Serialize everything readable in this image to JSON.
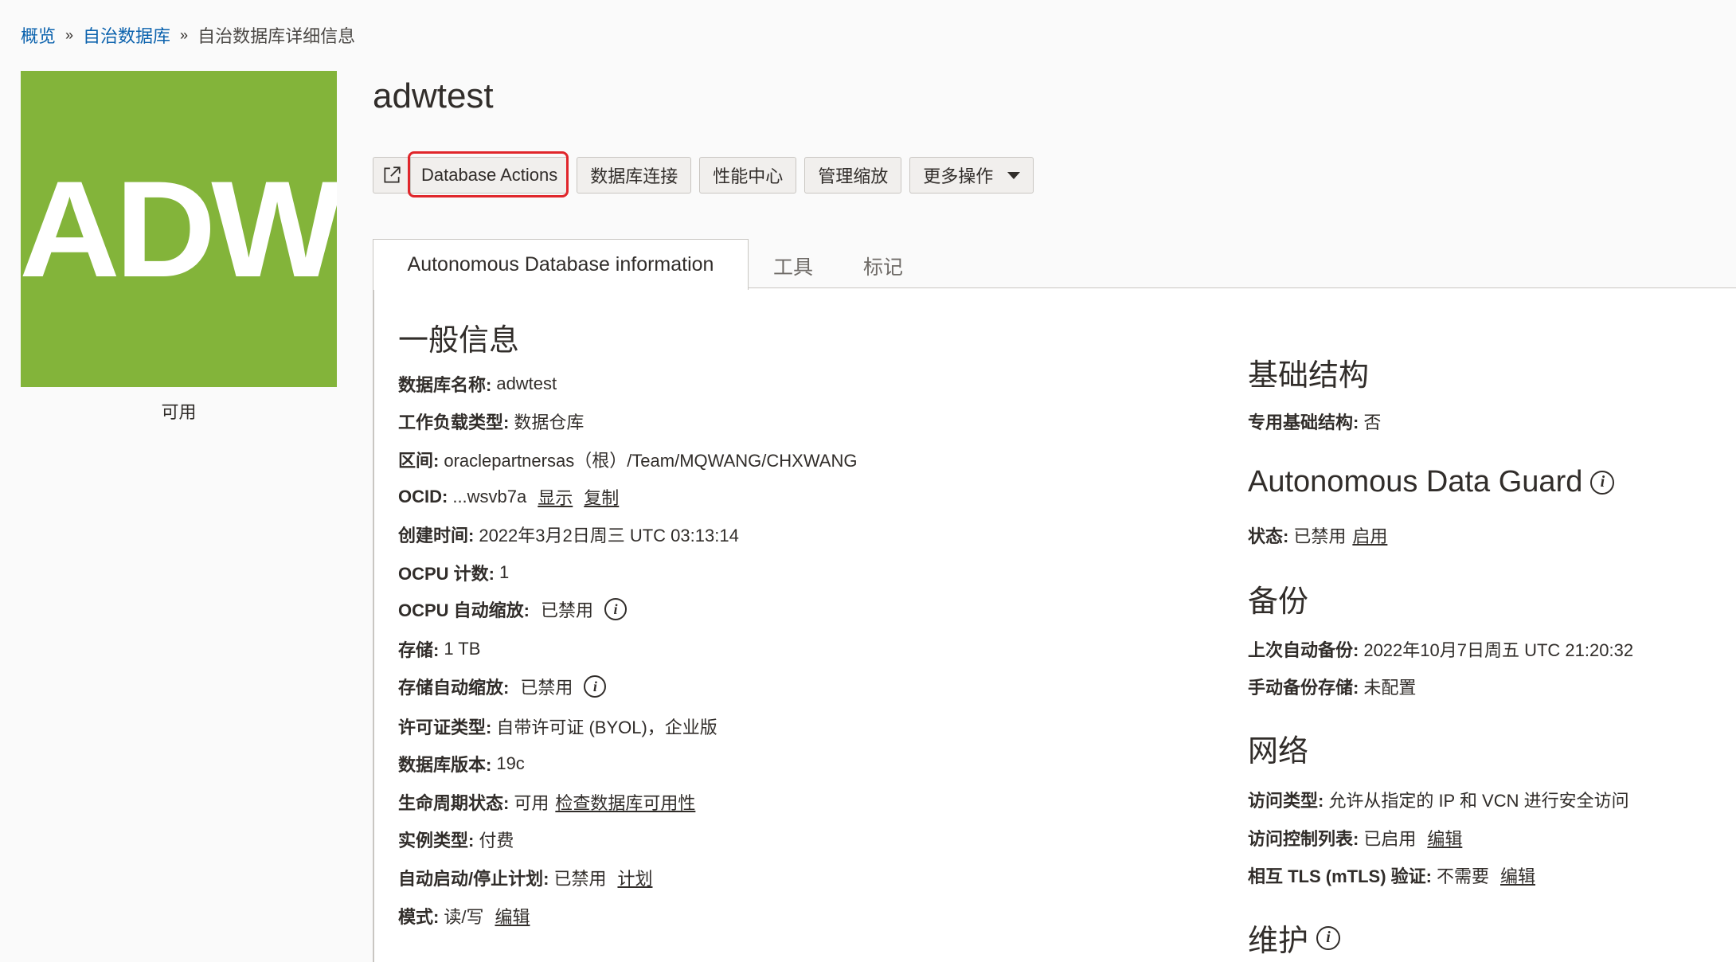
{
  "breadcrumb": {
    "items": [
      "概览",
      "自治数据库"
    ],
    "current": "自治数据库详细信息",
    "separator": "»"
  },
  "logo": {
    "text": "ADW",
    "color": "#83b43a"
  },
  "lifecycle_label": "可用",
  "title": "adwtest",
  "toolbar": {
    "open_icon": "external-link-icon",
    "database_actions": "Database Actions",
    "db_connection": "数据库连接",
    "performance_hub": "性能中心",
    "manage_scaling": "管理缩放",
    "more_actions": "更多操作"
  },
  "tabs": {
    "active": "Autonomous Database information",
    "tools": "工具",
    "tags": "标记"
  },
  "general": {
    "heading": "一般信息",
    "db_name": {
      "key": "数据库名称:",
      "value": "adwtest"
    },
    "workload": {
      "key": "工作负载类型:",
      "value": "数据仓库"
    },
    "compartment": {
      "key": "区间:",
      "value": "oraclepartnersas（根）/Team/MQWANG/CHXWANG"
    },
    "ocid": {
      "key": "OCID:",
      "value": "...wsvb7a",
      "show": "显示",
      "copy": "复制"
    },
    "created": {
      "key": "创建时间:",
      "value": "2022年3月2日周三 UTC 03:13:14"
    },
    "ocpu_count": {
      "key": "OCPU 计数:",
      "value": "1"
    },
    "ocpu_autoscale": {
      "key": "OCPU 自动缩放:",
      "value": "已禁用"
    },
    "storage": {
      "key": "存储:",
      "value": "1 TB"
    },
    "storage_autoscale": {
      "key": "存储自动缩放:",
      "value": "已禁用"
    },
    "license": {
      "key": "许可证类型:",
      "value": "自带许可证 (BYOL)，企业版"
    },
    "db_version": {
      "key": "数据库版本:",
      "value": "19c"
    },
    "lifecycle": {
      "key": "生命周期状态:",
      "value": "可用",
      "link": "检查数据库可用性"
    },
    "instance_type": {
      "key": "实例类型:",
      "value": "付费"
    },
    "schedule": {
      "key": "自动启动/停止计划:",
      "value": "已禁用",
      "link": "计划"
    },
    "mode": {
      "key": "模式:",
      "value": "读/写",
      "link": "编辑"
    }
  },
  "infra": {
    "heading": "基础结构",
    "dedicated": {
      "key": "专用基础结构:",
      "value": "否"
    }
  },
  "dataguard": {
    "heading": "Autonomous Data Guard",
    "status": {
      "key": "状态:",
      "value": "已禁用",
      "link": "启用"
    }
  },
  "backup": {
    "heading": "备份",
    "last_auto": {
      "key": "上次自动备份:",
      "value": "2022年10月7日周五 UTC 21:20:32"
    },
    "manual_store": {
      "key": "手动备份存储:",
      "value": "未配置"
    }
  },
  "network": {
    "heading": "网络",
    "access_type": {
      "key": "访问类型:",
      "value": "允许从指定的 IP 和 VCN 进行安全访问"
    },
    "acl": {
      "key": "访问控制列表:",
      "value": "已启用",
      "link": "编辑"
    },
    "mtls": {
      "key": "相互 TLS (mTLS) 验证:",
      "value": "不需要",
      "link": "编辑"
    }
  },
  "maintenance": {
    "heading": "维护"
  },
  "info_glyph": "i"
}
